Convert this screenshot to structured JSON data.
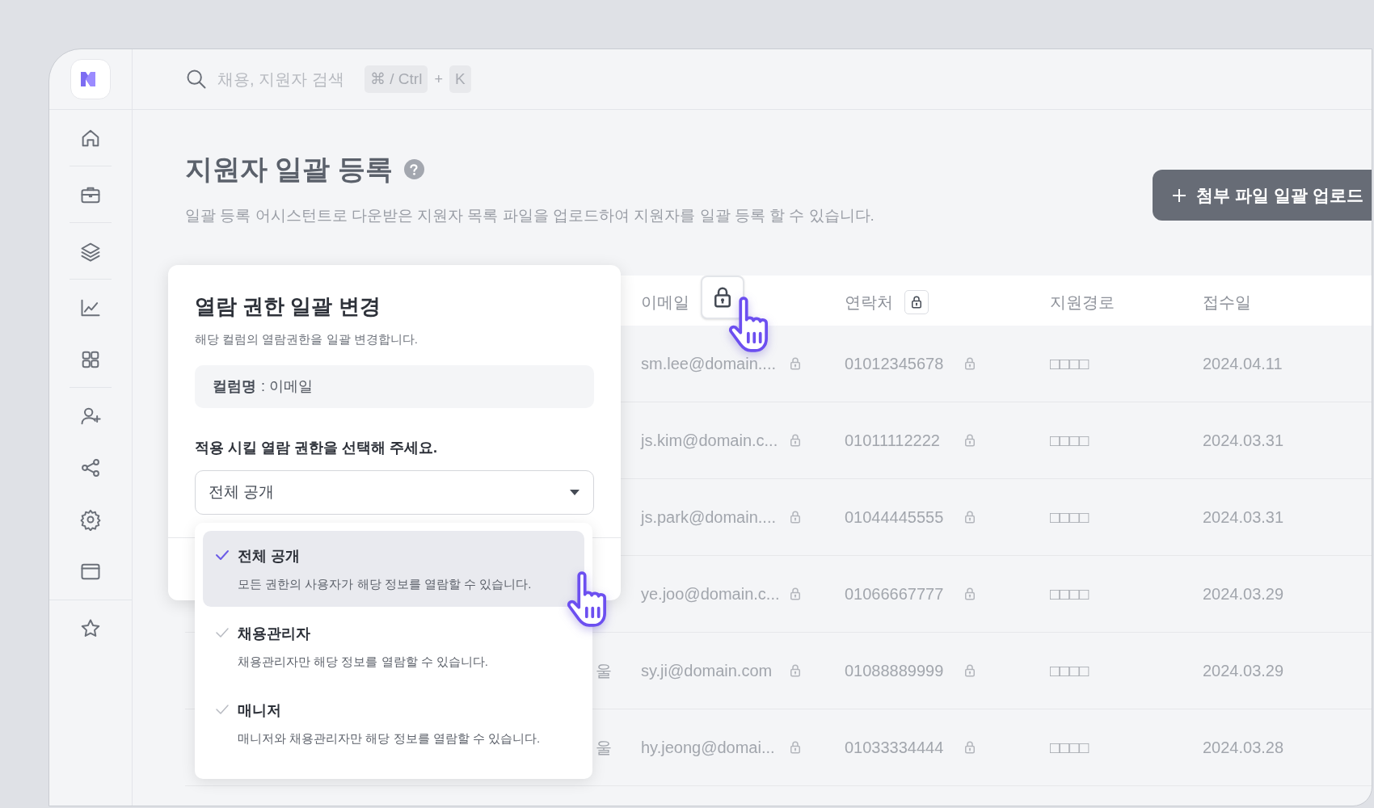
{
  "sidebar": {
    "groups": [
      {
        "items": [
          {
            "kind": "home"
          }
        ]
      },
      {
        "items": [
          {
            "kind": "briefcase"
          }
        ]
      },
      {
        "items": [
          {
            "kind": "layers"
          }
        ]
      },
      {
        "items": [
          {
            "kind": "chart"
          },
          {
            "kind": "grid"
          }
        ]
      },
      {
        "items": [
          {
            "kind": "user-plus"
          },
          {
            "kind": "share"
          },
          {
            "kind": "gear"
          },
          {
            "kind": "window"
          }
        ]
      },
      {
        "items": [
          {
            "kind": "star"
          }
        ]
      }
    ]
  },
  "search": {
    "placeholder": "채용, 지원자 검색",
    "keys": [
      "⌘ / Ctrl",
      "K"
    ],
    "joiner": "+"
  },
  "page": {
    "title": "지원자 일괄 등록",
    "description": "일괄 등록 어시스턴트로 다운받은 지원자 목록 파일을 업로드하여 지원자를 일괄 등록 할 수 있습니다.",
    "upload_button": "첨부 파일 일괄 업로드"
  },
  "table": {
    "columns": [
      {
        "label": "이메일",
        "kind": "hover"
      },
      {
        "label": "연락처",
        "kind": "lockable"
      },
      {
        "label": "지원경로",
        "kind": "plain"
      },
      {
        "label": "접수일",
        "kind": "plain"
      }
    ],
    "rows": [
      {
        "email": "sm.lee@domain....",
        "phone": "01012345678",
        "route": "□□□□",
        "date": "2024.04.11"
      },
      {
        "email": "js.kim@domain.c...",
        "phone": "01011112222",
        "route": "□□□□",
        "date": "2024.03.31"
      },
      {
        "email": "js.park@domain....",
        "phone": "01044445555",
        "route": "□□□□",
        "date": "2024.03.31"
      },
      {
        "email": "ye.joo@domain.c...",
        "phone": "01066667777",
        "route": "□□□□",
        "date": "2024.03.29"
      },
      {
        "column_1": "울",
        "email": "sy.ji@domain.com",
        "phone": "01088889999",
        "route": "□□□□",
        "date": "2024.03.29"
      },
      {
        "column_1": "울",
        "email": "hy.jeong@domai...",
        "phone": "01033334444",
        "route": "□□□□",
        "date": "2024.03.28"
      }
    ]
  },
  "popover": {
    "title": "열람 권한 일괄 변경",
    "subtitle": "해당 컬럼의 열람권한을 일괄 변경합니다.",
    "column_label": "컬럼명",
    "column_value": ": 이메일",
    "prompt": "적용 시킬 열람 권한을 선택해 주세요.",
    "select": {
      "value": "전체 공개",
      "expanded": true
    },
    "options": [
      {
        "label": "전체 공개",
        "description": "모든 권한의 사용자가 해당 정보를 열람할 수 있습니다.",
        "selected": true
      },
      {
        "label": "채용관리자",
        "description": "채용관리자만 해당 정보를 열람할 수 있습니다.",
        "selected": false
      },
      {
        "label": "매니저",
        "description": "매니저와 채용관리자만 해당 정보를 열람할 수 있습니다.",
        "selected": false
      }
    ]
  }
}
